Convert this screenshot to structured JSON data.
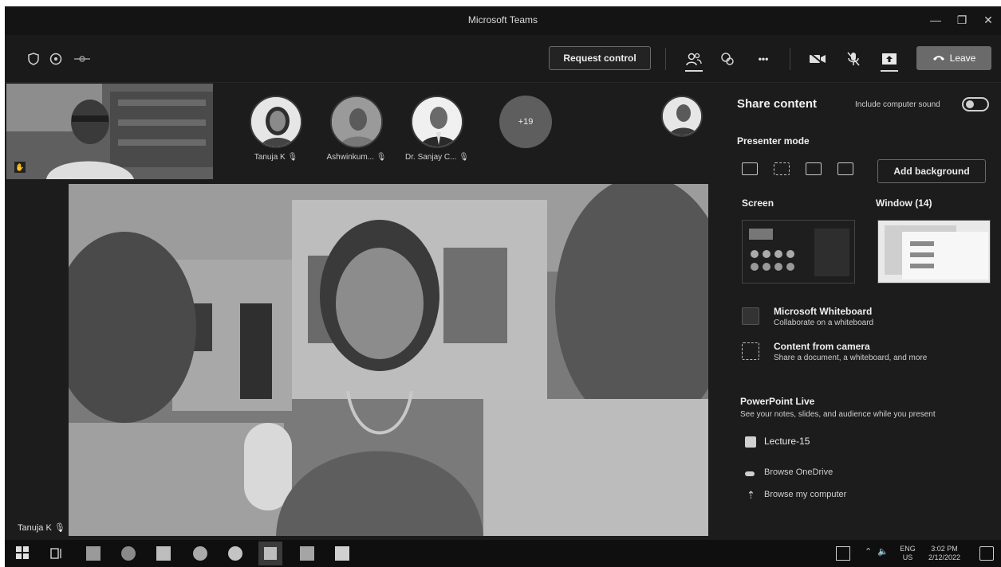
{
  "window": {
    "title": "Microsoft Teams"
  },
  "toolbar": {
    "request_control_label": "Request control",
    "leave_label": "Leave",
    "more_label": "•••"
  },
  "roster": {
    "participants": [
      {
        "name": "Tanuja K"
      },
      {
        "name": "Ashwinkum..."
      },
      {
        "name": "Dr. Sanjay C..."
      }
    ],
    "more_count": "+19"
  },
  "main_video": {
    "speaker_name": "Tanuja K"
  },
  "share_panel": {
    "title": "Share content",
    "include_sound_label": "Include computer sound",
    "presenter_mode_label": "Presenter mode",
    "add_background_label": "Add background",
    "screen_label": "Screen",
    "window_label": "Window (14)",
    "options": [
      {
        "title": "Microsoft Whiteboard",
        "subtitle": "Collaborate on a whiteboard"
      },
      {
        "title": "Content from camera",
        "subtitle": "Share a document, a whiteboard, and more"
      }
    ],
    "powerpoint_title": "PowerPoint Live",
    "powerpoint_subtitle": "See your notes, slides, and audience while you present",
    "recent_file": "Lecture-15",
    "browse_onedrive": "Browse OneDrive",
    "browse_computer": "Browse my computer"
  },
  "taskbar": {
    "lang_top": "ENG",
    "lang_bottom": "US",
    "time": "3:02 PM",
    "date": "2/12/2022"
  },
  "colors": {
    "leave_button": "#6a6a6a",
    "panel_bg": "#1c1c1c",
    "toolbar_bg": "#1a1a1a"
  }
}
